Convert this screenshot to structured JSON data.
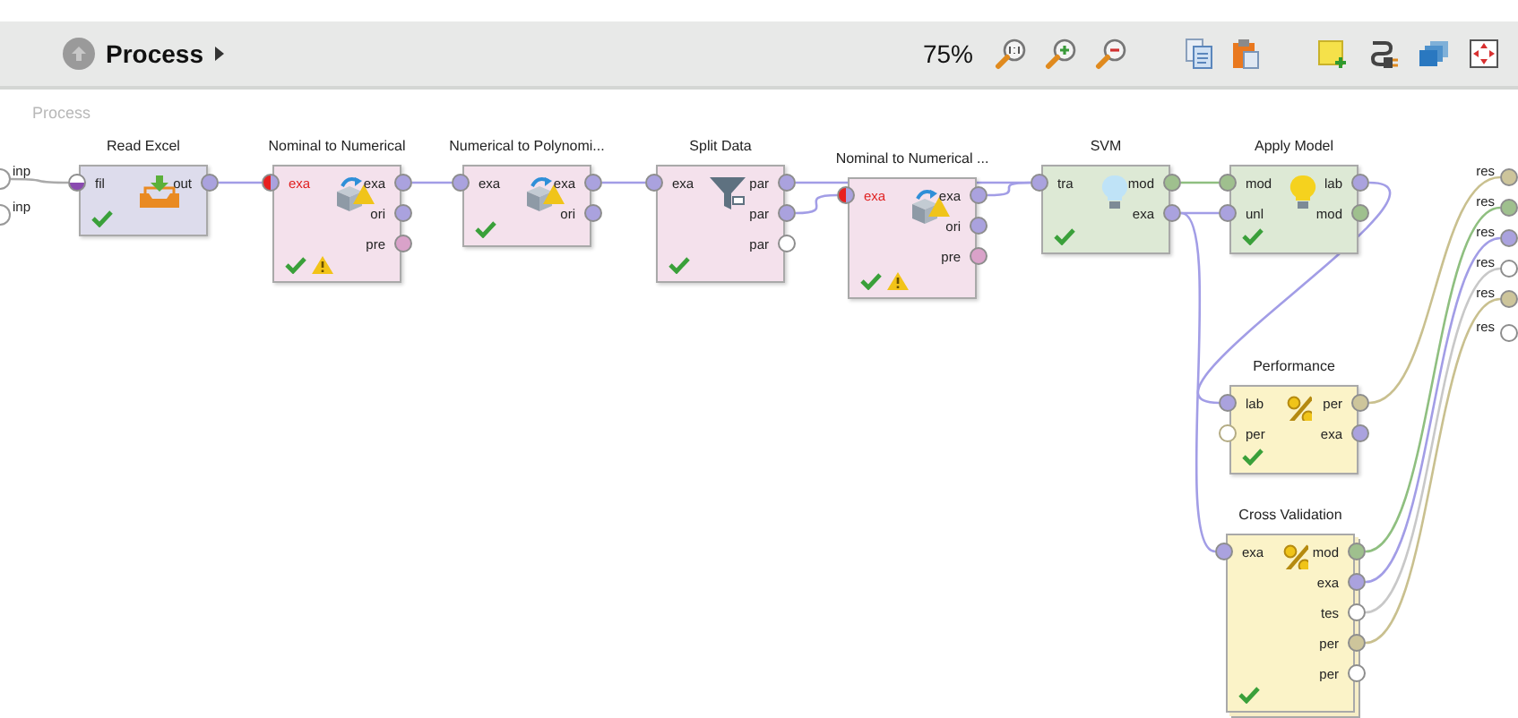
{
  "toolbar": {
    "title": "Process",
    "zoom": "75%"
  },
  "breadcrumb": "Process",
  "process_inputs": [
    {
      "label": "inp"
    },
    {
      "label": "inp"
    }
  ],
  "operators": [
    {
      "name": "Read Excel",
      "kind": "read",
      "valid": true,
      "warning": false,
      "inputs": [
        {
          "label": "fil",
          "kind": "file",
          "error": false
        }
      ],
      "outputs": [
        {
          "label": "out",
          "kind": "example"
        }
      ]
    },
    {
      "name": "Nominal to Numerical",
      "kind": "convert",
      "valid": true,
      "warning": true,
      "inputs": [
        {
          "label": "exa",
          "kind": "example",
          "error": true
        }
      ],
      "outputs": [
        {
          "label": "exa",
          "kind": "example"
        },
        {
          "label": "ori",
          "kind": "example"
        },
        {
          "label": "pre",
          "kind": "preprocessing"
        }
      ]
    },
    {
      "name": "Numerical to Polynomi...",
      "kind": "convert",
      "valid": true,
      "warning": false,
      "inputs": [
        {
          "label": "exa",
          "kind": "example",
          "error": false
        }
      ],
      "outputs": [
        {
          "label": "exa",
          "kind": "example"
        },
        {
          "label": "ori",
          "kind": "example"
        }
      ]
    },
    {
      "name": "Split Data",
      "kind": "split",
      "valid": true,
      "warning": false,
      "inputs": [
        {
          "label": "exa",
          "kind": "example",
          "error": false
        }
      ],
      "outputs": [
        {
          "label": "par",
          "kind": "example"
        },
        {
          "label": "par",
          "kind": "example"
        },
        {
          "label": "par",
          "kind": "empty"
        }
      ]
    },
    {
      "name": "Nominal to Numerical ...",
      "kind": "convert",
      "valid": true,
      "warning": true,
      "inputs": [
        {
          "label": "exa",
          "kind": "example",
          "error": true
        }
      ],
      "outputs": [
        {
          "label": "exa",
          "kind": "example"
        },
        {
          "label": "ori",
          "kind": "example"
        },
        {
          "label": "pre",
          "kind": "preprocessing"
        }
      ]
    },
    {
      "name": "SVM",
      "kind": "learner",
      "valid": true,
      "warning": false,
      "inputs": [
        {
          "label": "tra",
          "kind": "example",
          "error": false
        }
      ],
      "outputs": [
        {
          "label": "mod",
          "kind": "model"
        },
        {
          "label": "exa",
          "kind": "example"
        }
      ]
    },
    {
      "name": "Apply Model",
      "kind": "apply",
      "valid": true,
      "warning": false,
      "inputs": [
        {
          "label": "mod",
          "kind": "model",
          "error": false
        },
        {
          "label": "unl",
          "kind": "example",
          "error": false
        }
      ],
      "outputs": [
        {
          "label": "lab",
          "kind": "example"
        },
        {
          "label": "mod",
          "kind": "model"
        }
      ]
    },
    {
      "name": "Performance",
      "kind": "performance",
      "valid": true,
      "warning": false,
      "inputs": [
        {
          "label": "lab",
          "kind": "example",
          "error": false
        },
        {
          "label": "per",
          "kind": "performance-optional",
          "error": false
        }
      ],
      "outputs": [
        {
          "label": "per",
          "kind": "performance"
        },
        {
          "label": "exa",
          "kind": "example"
        }
      ]
    },
    {
      "name": "Cross Validation",
      "kind": "validation",
      "valid": true,
      "warning": false,
      "inputs": [
        {
          "label": "exa",
          "kind": "example",
          "error": false
        }
      ],
      "outputs": [
        {
          "label": "mod",
          "kind": "model"
        },
        {
          "label": "exa",
          "kind": "example"
        },
        {
          "label": "tes",
          "kind": "empty"
        },
        {
          "label": "per",
          "kind": "performance"
        },
        {
          "label": "per",
          "kind": "empty"
        }
      ]
    }
  ],
  "results": [
    {
      "label": "res",
      "kind": "performance"
    },
    {
      "label": "res",
      "kind": "model"
    },
    {
      "label": "res",
      "kind": "example"
    },
    {
      "label": "res",
      "kind": "empty"
    },
    {
      "label": "res",
      "kind": "performance"
    },
    {
      "label": "res",
      "kind": "empty"
    }
  ]
}
